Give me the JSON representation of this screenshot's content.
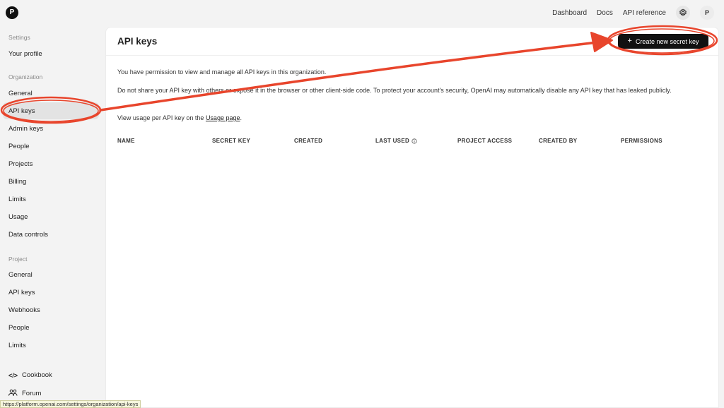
{
  "topbar": {
    "logo_letter": "P",
    "links": [
      "Dashboard",
      "Docs",
      "API reference"
    ],
    "avatar_letter": "P"
  },
  "sidebar": {
    "settings_title": "Settings",
    "your_profile": "Your profile",
    "organization_title": "Organization",
    "org_items": [
      "General",
      "API keys",
      "Admin keys",
      "People",
      "Projects",
      "Billing",
      "Limits",
      "Usage",
      "Data controls"
    ],
    "project_title": "Project",
    "project_items": [
      "General",
      "API keys",
      "Webhooks",
      "People",
      "Limits"
    ],
    "footer": {
      "cookbook": "Cookbook",
      "forum": "Forum"
    }
  },
  "main": {
    "title": "API keys",
    "create_button": "Create new secret key",
    "permission_text": "You have permission to view and manage all API keys in this organization.",
    "warning_text": "Do not share your API key with others or expose it in the browser or other client-side code. To protect your account's security, OpenAI may automatically disable any API key that has leaked publicly.",
    "usage_prefix": "View usage per API key on the",
    "usage_link": "Usage page",
    "usage_suffix": ".",
    "columns": [
      "NAME",
      "SECRET KEY",
      "CREATED",
      "LAST USED",
      "PROJECT ACCESS",
      "CREATED BY",
      "PERMISSIONS"
    ]
  },
  "statusbar": {
    "url": "https://platform.openai.com/settings/organization/api-keys"
  },
  "colors": {
    "annotation": "#e8452c",
    "button_bg": "#111111",
    "active_bg": "#e3e3e3"
  }
}
